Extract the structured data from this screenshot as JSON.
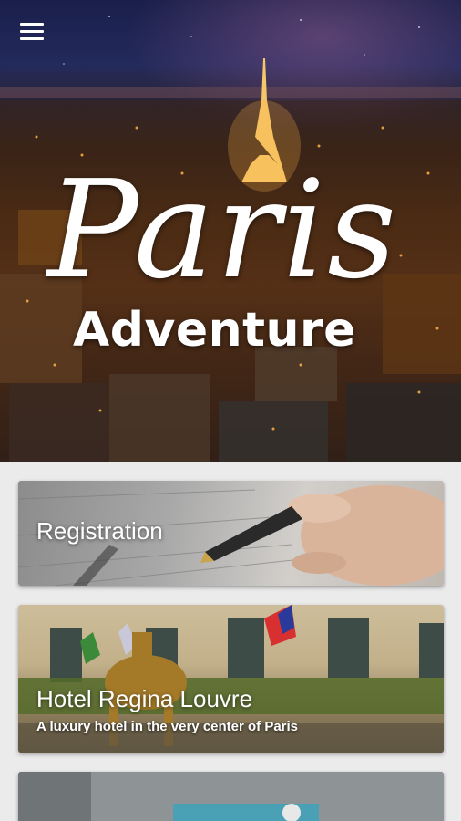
{
  "hero": {
    "title_script": "Paris",
    "title_bold": "Adventure",
    "menu_icon": "hamburger-menu-icon"
  },
  "cards": [
    {
      "title": "Registration",
      "image": "pen-on-form-photo"
    },
    {
      "title": "Hotel Regina Louvre",
      "subtitle": "A luxury hotel in the very center of Paris",
      "image": "hotel-facade-photo"
    },
    {
      "title": "",
      "image": "street-photo"
    }
  ],
  "colors": {
    "background": "#ebebeb",
    "text_on_image": "#ffffff"
  }
}
